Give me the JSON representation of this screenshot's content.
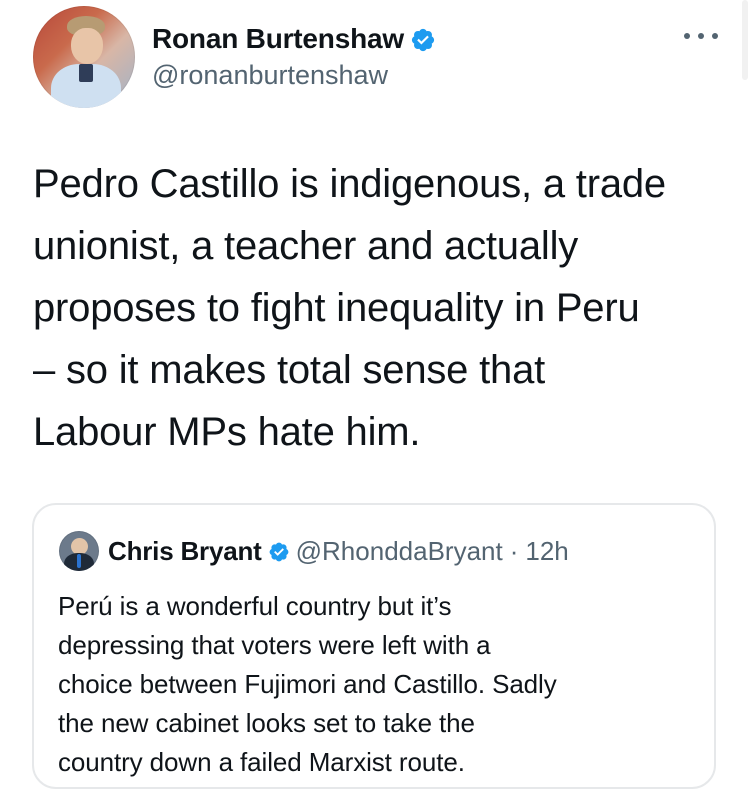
{
  "author": {
    "display_name": "Ronan Burtenshaw",
    "handle": "@ronanburtenshaw",
    "verified": true
  },
  "tweet": {
    "text": "Pedro Castillo is indigenous, a trade\nunionist, a teacher and actually\nproposes to fight inequality in Peru\n– so it makes total sense that\nLabour MPs hate him."
  },
  "quoted_tweet": {
    "display_name": "Chris Bryant",
    "handle": "@RhonddaBryant",
    "separator": "·",
    "time": "12h",
    "verified": true,
    "text": "Perú is a wonderful country but it’s\ndepressing that voters were left with a\nchoice between Fujimori and Castillo. Sadly\nthe new cabinet looks set to take the\ncountry down a failed Marxist route."
  },
  "icons": {
    "more": "more-horizontal-icon",
    "verified": "verified-badge-icon"
  },
  "colors": {
    "accent": "#1d9bf0",
    "text_primary": "#0f1419",
    "text_secondary": "#536471",
    "border": "#e6e8ea"
  }
}
